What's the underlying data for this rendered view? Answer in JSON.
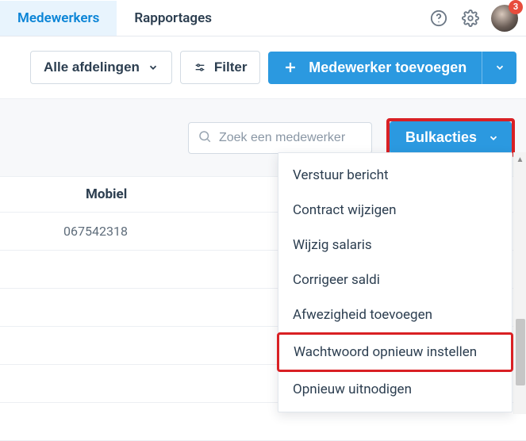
{
  "colors": {
    "primary": "#2b99e0",
    "danger": "#d92024",
    "badge": "#e74c3c"
  },
  "tabs": {
    "employees": "Medewerkers",
    "reports": "Rapportages"
  },
  "header": {
    "notification_count": "3"
  },
  "toolbar": {
    "departments_label": "Alle afdelingen",
    "filter_label": "Filter",
    "add_employee_label": "Medewerker toevoegen"
  },
  "search": {
    "placeholder": "Zoek een medewerker"
  },
  "bulk": {
    "label": "Bulkacties",
    "items": [
      "Verstuur bericht",
      "Contract wijzigen",
      "Wijzig salaris",
      "Corrigeer saldi",
      "Afwezigheid toevoegen",
      "Wachtwoord opnieuw instellen",
      "Opnieuw uitnodigen"
    ],
    "highlighted_index": 5
  },
  "table": {
    "columns": {
      "mobiel": "Mobiel"
    },
    "rows": [
      {
        "mobiel": "067542318"
      },
      {
        "mobiel": ""
      },
      {
        "mobiel": ""
      },
      {
        "mobiel": ""
      },
      {
        "mobiel": ""
      },
      {
        "mobiel": ""
      }
    ]
  }
}
